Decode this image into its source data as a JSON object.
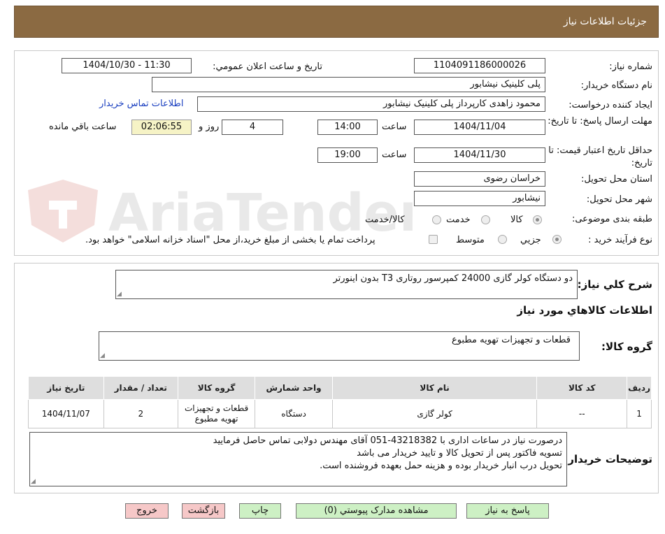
{
  "header": {
    "title": "جزئیات اطلاعات نیاز"
  },
  "fields": {
    "need_number": {
      "label": "شماره نیاز:",
      "value": "1104091186000026"
    },
    "announce_datetime": {
      "label": "تاریخ و ساعت اعلان عمومي:",
      "value": "1404/10/30 - 11:30"
    },
    "buyer_org": {
      "label": "نام دستگاه خريدار:",
      "value": "پلی کلینیک نیشابور"
    },
    "creator": {
      "label": "ايجاد كننده درخواست:",
      "value": "محمود زاهدی کارپرداز پلی کلینیک نیشابور",
      "contact_link": "اطلاعات تماس خريدار"
    },
    "reply_deadline": {
      "label": "مهلت ارسال پاسخ: تا تاريخ:",
      "date": "1404/11/04",
      "time_label": "ساعت",
      "time": "14:00",
      "days": "4",
      "days_label": "روز و",
      "remaining": "02:06:55",
      "remaining_label": "ساعت باقي مانده"
    },
    "price_validity": {
      "label": "حداقل تاريخ اعتبار قيمت: تا تاريخ:",
      "date": "1404/11/30",
      "time_label": "ساعت",
      "time": "19:00"
    },
    "province": {
      "label": "استان محل تحويل:",
      "value": "خراسان رضوی"
    },
    "city": {
      "label": "شهر محل تحويل:",
      "value": "نیشابور"
    },
    "category": {
      "label": "طبقه بندی موضوعی:",
      "options": [
        "کالا",
        "خدمت",
        "کالا/خدمت"
      ],
      "selected": "کالا"
    },
    "process": {
      "label": "نوع فرآيند خريد :",
      "options": [
        "جزيي",
        "متوسط"
      ],
      "selected": "جزيي",
      "payment_note": "پرداخت تمام يا بخشی از مبلغ خريد،از محل \"اسناد خزانه اسلامی\" خواهد بود."
    }
  },
  "description": {
    "label": "شرح كلي نياز:",
    "value": "دو دستگاه کولر گازی 24000 کمپرسور روتاری T3 بدون اینورتر"
  },
  "items_section": {
    "title": "اطلاعات كالاهاي مورد نياز",
    "group_label": "گروه كالا:",
    "group_value": "قطعات و تجهيزات تهويه مطبوع"
  },
  "table": {
    "headers": [
      "رديف",
      "كد كالا",
      "نام كالا",
      "واحد شمارش",
      "گروه كالا",
      "تعداد / مقدار",
      "تاريخ نياز"
    ],
    "rows": [
      [
        "1",
        "--",
        "کولر گازی",
        "دستگاه",
        "قطعات و تجهيزات تهويه مطبوع",
        "2",
        "1404/11/07"
      ]
    ]
  },
  "buyer_notes": {
    "label": "توضيحات خريدار:",
    "lines": [
      "درصورت نیاز در ساعات اداری با 43218382-051 آقای مهندس دولابی تماس حاصل فرمایید",
      "تسویه فاکتور پس از تحویل کالا و تایید خریدار می باشد",
      "تحویل درب انبار خریدار بوده و هزینه حمل بعهده فروشنده است."
    ]
  },
  "buttons": {
    "reply": "پاسخ به نياز",
    "attachments": "مشاهده مدارک پيوستي (0)",
    "print": "چاپ",
    "back": "بازگشت",
    "exit": "خروج"
  },
  "watermark": {
    "text": "AriaTender.neT"
  },
  "colors": {
    "header_bg": "#8b6a42",
    "timer_bg": "#f6f3c6",
    "button_green": "#cdf0c4",
    "button_pink": "#f6c8c8",
    "link": "#1a3fc0"
  }
}
